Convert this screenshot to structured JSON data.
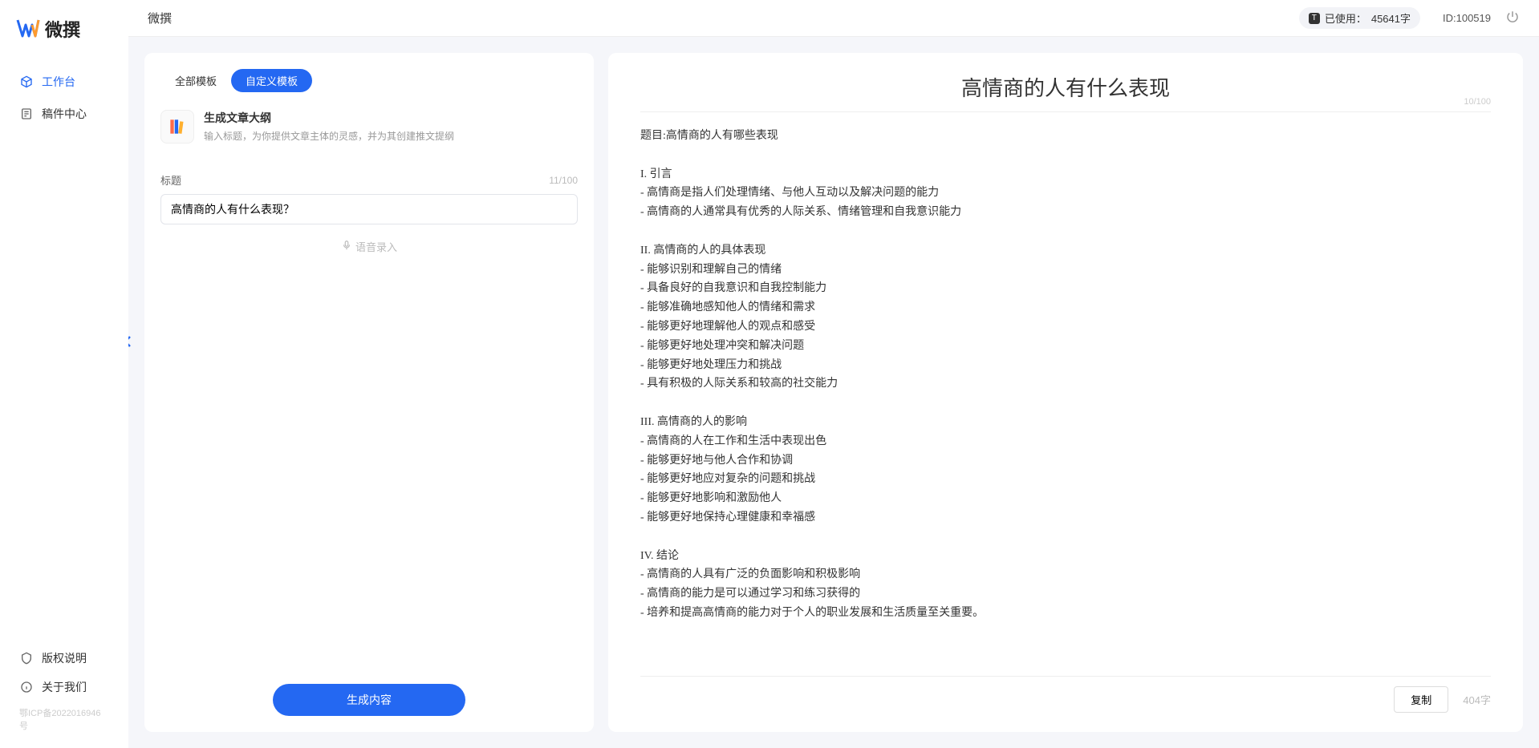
{
  "brand": "微撰",
  "sidebar": {
    "items": [
      {
        "label": "工作台",
        "active": true
      },
      {
        "label": "稿件中心",
        "active": false
      }
    ],
    "bottom": [
      {
        "label": "版权说明"
      },
      {
        "label": "关于我们"
      }
    ],
    "icp": "鄂ICP备2022016946号"
  },
  "topbar": {
    "title": "微撰",
    "usage_prefix": "已使用：",
    "usage_value": "45641字",
    "id_label": "ID:100519"
  },
  "left": {
    "tabs": [
      {
        "label": "全部模板",
        "active": false
      },
      {
        "label": "自定义模板",
        "active": true
      }
    ],
    "template": {
      "title": "生成文章大纲",
      "desc": "输入标题，为你提供文章主体的灵感，并为其创建推文提纲"
    },
    "form": {
      "label": "标题",
      "counter": "11/100",
      "input_value": "高情商的人有什么表现？",
      "voice_text": "语音录入"
    },
    "generate_btn": "生成内容"
  },
  "output": {
    "title": "高情商的人有什么表现",
    "title_counter": "10/100",
    "body": "题目:高情商的人有哪些表现\n\nI. 引言\n- 高情商是指人们处理情绪、与他人互动以及解决问题的能力\n- 高情商的人通常具有优秀的人际关系、情绪管理和自我意识能力\n\nII. 高情商的人的具体表现\n- 能够识别和理解自己的情绪\n- 具备良好的自我意识和自我控制能力\n- 能够准确地感知他人的情绪和需求\n- 能够更好地理解他人的观点和感受\n- 能够更好地处理冲突和解决问题\n- 能够更好地处理压力和挑战\n- 具有积极的人际关系和较高的社交能力\n\nIII. 高情商的人的影响\n- 高情商的人在工作和生活中表现出色\n- 能够更好地与他人合作和协调\n- 能够更好地应对复杂的问题和挑战\n- 能够更好地影响和激励他人\n- 能够更好地保持心理健康和幸福感\n\nIV. 结论\n- 高情商的人具有广泛的负面影响和积极影响\n- 高情商的能力是可以通过学习和练习获得的\n- 培养和提高高情商的能力对于个人的职业发展和生活质量至关重要。",
    "copy_btn": "复制",
    "word_count": "404字"
  }
}
